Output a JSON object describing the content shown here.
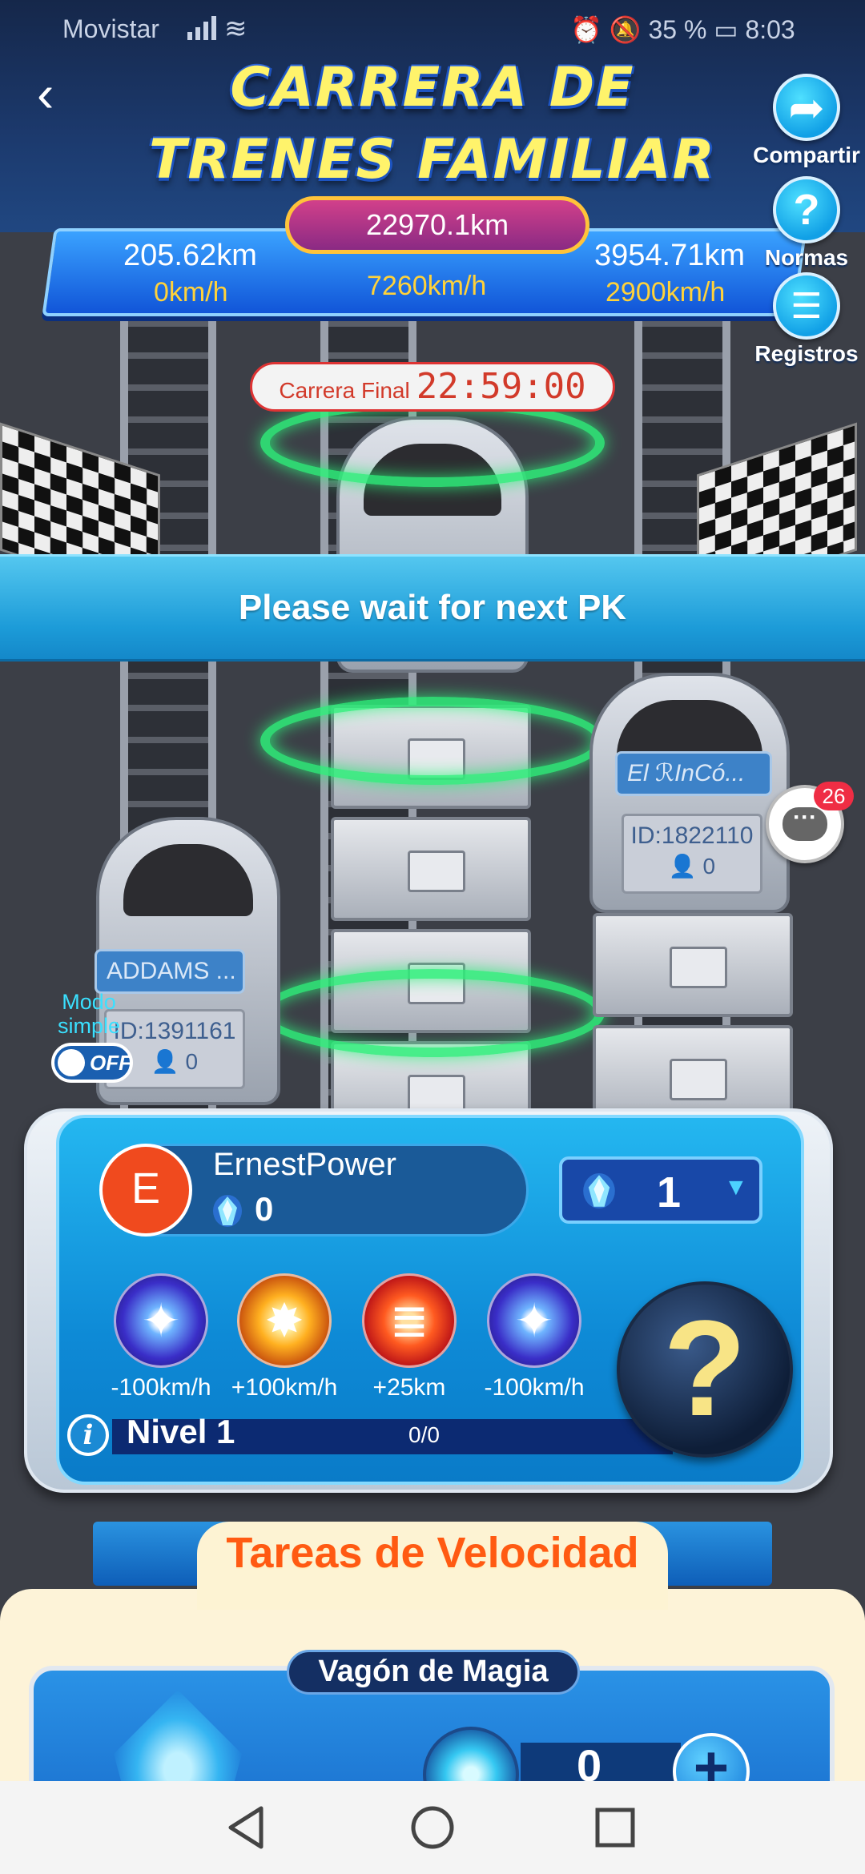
{
  "status_bar": {
    "carrier": "Movistar",
    "right": "⏰ 🔕 35 % ▭ 8:03"
  },
  "header": {
    "title_line_1": "CARRERA DE",
    "title_line_2": "TRENES FAMILIAR",
    "back_icon": "‹"
  },
  "side_buttons": [
    {
      "label": "Compartir",
      "icon": "share-arrow-icon",
      "glyph": "➦"
    },
    {
      "label": "Normas",
      "icon": "question-icon",
      "glyph": "?"
    },
    {
      "label": "Registros",
      "icon": "list-icon",
      "glyph": "☰"
    }
  ],
  "race": {
    "total_distance": "22970.1km",
    "left_team": {
      "distance": "205.62km",
      "speed": "0km/h"
    },
    "my_team": {
      "speed": "7260km/h"
    },
    "right_team": {
      "distance": "3954.71km",
      "speed": "2900km/h"
    },
    "final_label": "Carrera Final",
    "final_timer": "22:59:00",
    "wait_message": "Please wait for next PK"
  },
  "trains": [
    {
      "name": "ADDAMS ...",
      "id": "ID:1391161",
      "members": "0"
    },
    {
      "name": "El ℛInCó...",
      "id": "ID:1822110",
      "members": "0"
    }
  ],
  "chat": {
    "badge": "26",
    "icon": "chat-bubble-icon"
  },
  "simple_mode": {
    "label": "Modo simple",
    "toggle_text": "OFF",
    "enabled": false
  },
  "user": {
    "avatar_letter": "E",
    "name": "ErnestPower",
    "gem_balance": "0",
    "gem_select_value": "1",
    "avatar_color": "#f04a1e"
  },
  "powers": [
    {
      "label": "-100km/h",
      "icon": "blue-sparkle-icon"
    },
    {
      "label": "+100km/h",
      "icon": "orange-burst-icon"
    },
    {
      "label": "+25km",
      "icon": "red-spring-icon"
    },
    {
      "label": "-100km/h",
      "icon": "blue-sparkle-icon"
    }
  ],
  "mystery": {
    "glyph": "?"
  },
  "level": {
    "label": "Nivel 1",
    "progress": "0/0",
    "info_glyph": "i"
  },
  "tasks": {
    "title": "Tareas de Velocidad",
    "card_title": "Vagón de Magia",
    "amount": "0",
    "plus_glyph": "+"
  },
  "colors": {
    "accent": "#1c9bd8",
    "title_yellow": "#fff36b",
    "task_orange": "#ff5a12",
    "ring_green": "#2ef07a"
  }
}
